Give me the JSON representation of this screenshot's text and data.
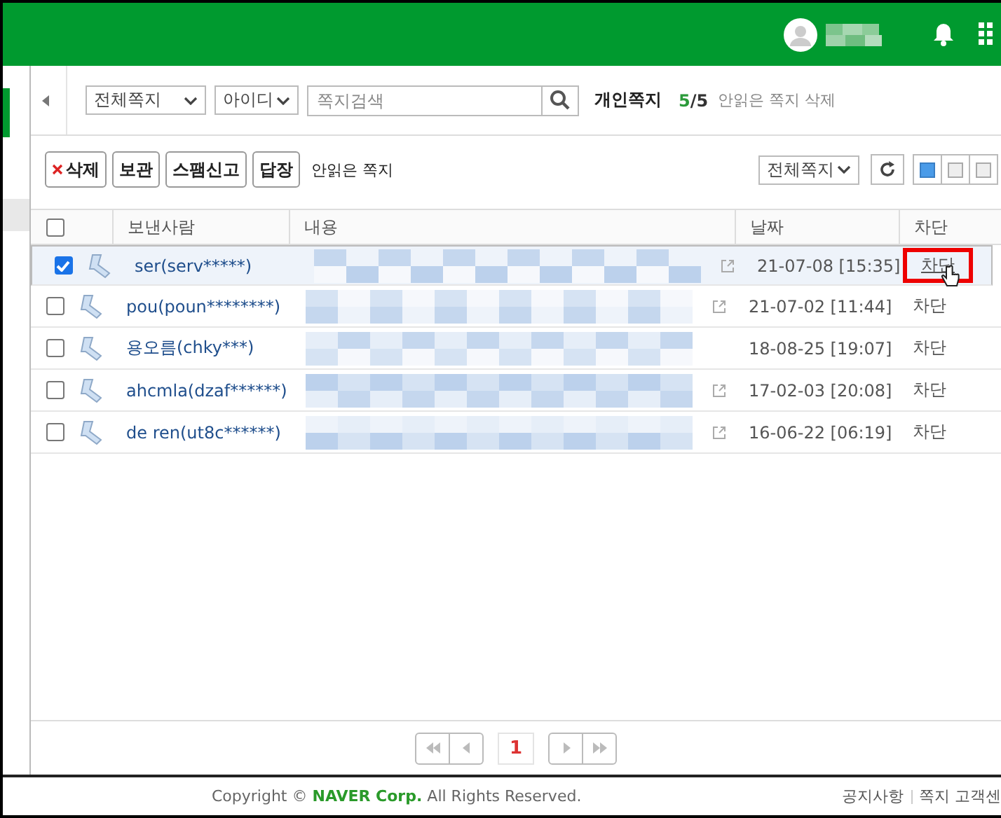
{
  "toolbar": {
    "folder_select": "전체쪽지",
    "field_select": "아이디",
    "search": {
      "placeholder": "쪽지검색"
    },
    "title": "개인쪽지",
    "count_read": "5",
    "count_sep": "/",
    "count_total": "5",
    "delete_unread": "안읽은 쪽지 삭제"
  },
  "actions": {
    "buttons": [
      {
        "label": "삭제",
        "kind": "delete"
      },
      {
        "label": "보관",
        "kind": "plain"
      },
      {
        "label": "스팸신고",
        "kind": "plain"
      },
      {
        "label": "답장",
        "kind": "plain"
      }
    ],
    "unread_link": "안읽은 쪽지",
    "filter_select": "전체쪽지",
    "views": [
      {
        "selected": true
      },
      {
        "selected": false
      },
      {
        "selected": false
      }
    ]
  },
  "table": {
    "select_all": false,
    "columns": [
      "보낸사람",
      "내용",
      "날짜",
      "차단"
    ],
    "rows": [
      {
        "checked": true,
        "sender": "ser(serv*****)",
        "has_link": true,
        "date": "21-07-08 [15:35]",
        "block": "차단",
        "highlighted": true
      },
      {
        "checked": false,
        "sender": "pou(poun********)",
        "has_link": true,
        "date": "21-07-02 [11:44]",
        "block": "차단",
        "highlighted": false
      },
      {
        "checked": false,
        "sender": "용오름(chky***)",
        "has_link": false,
        "date": "18-08-25 [19:07]",
        "block": "차단",
        "highlighted": false
      },
      {
        "checked": false,
        "sender": "ahcmla(dzaf******)",
        "has_link": true,
        "date": "17-02-03 [20:08]",
        "block": "차단",
        "highlighted": false
      },
      {
        "checked": false,
        "sender": "de ren(ut8c******)",
        "has_link": true,
        "date": "16-06-22 [06:19]",
        "block": "차단",
        "highlighted": false
      }
    ]
  },
  "pagination": {
    "pages": [
      {
        "label": "1",
        "selected": true
      }
    ]
  },
  "footer": {
    "copyright_pre": "Copyright ©",
    "company": "NAVER Corp.",
    "copyright_post": "All Rights Reserved.",
    "links": [
      "공지사항",
      "쪽지 고객센"
    ]
  }
}
